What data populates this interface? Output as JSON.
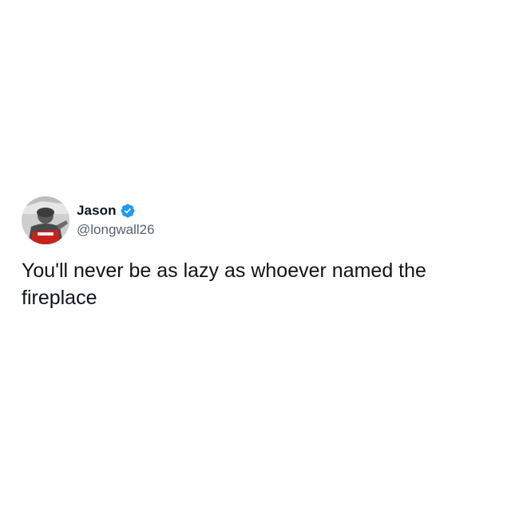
{
  "author": {
    "display_name": "Jason",
    "handle": "@longwall26",
    "verified": true,
    "verified_color": "#1d9bf0",
    "avatar_icon": "profile-photo"
  },
  "tweet": {
    "text": "You'll never be as lazy as whoever named the fireplace"
  },
  "colors": {
    "text_primary": "#0f1419",
    "text_secondary": "#536471",
    "background": "#ffffff"
  }
}
